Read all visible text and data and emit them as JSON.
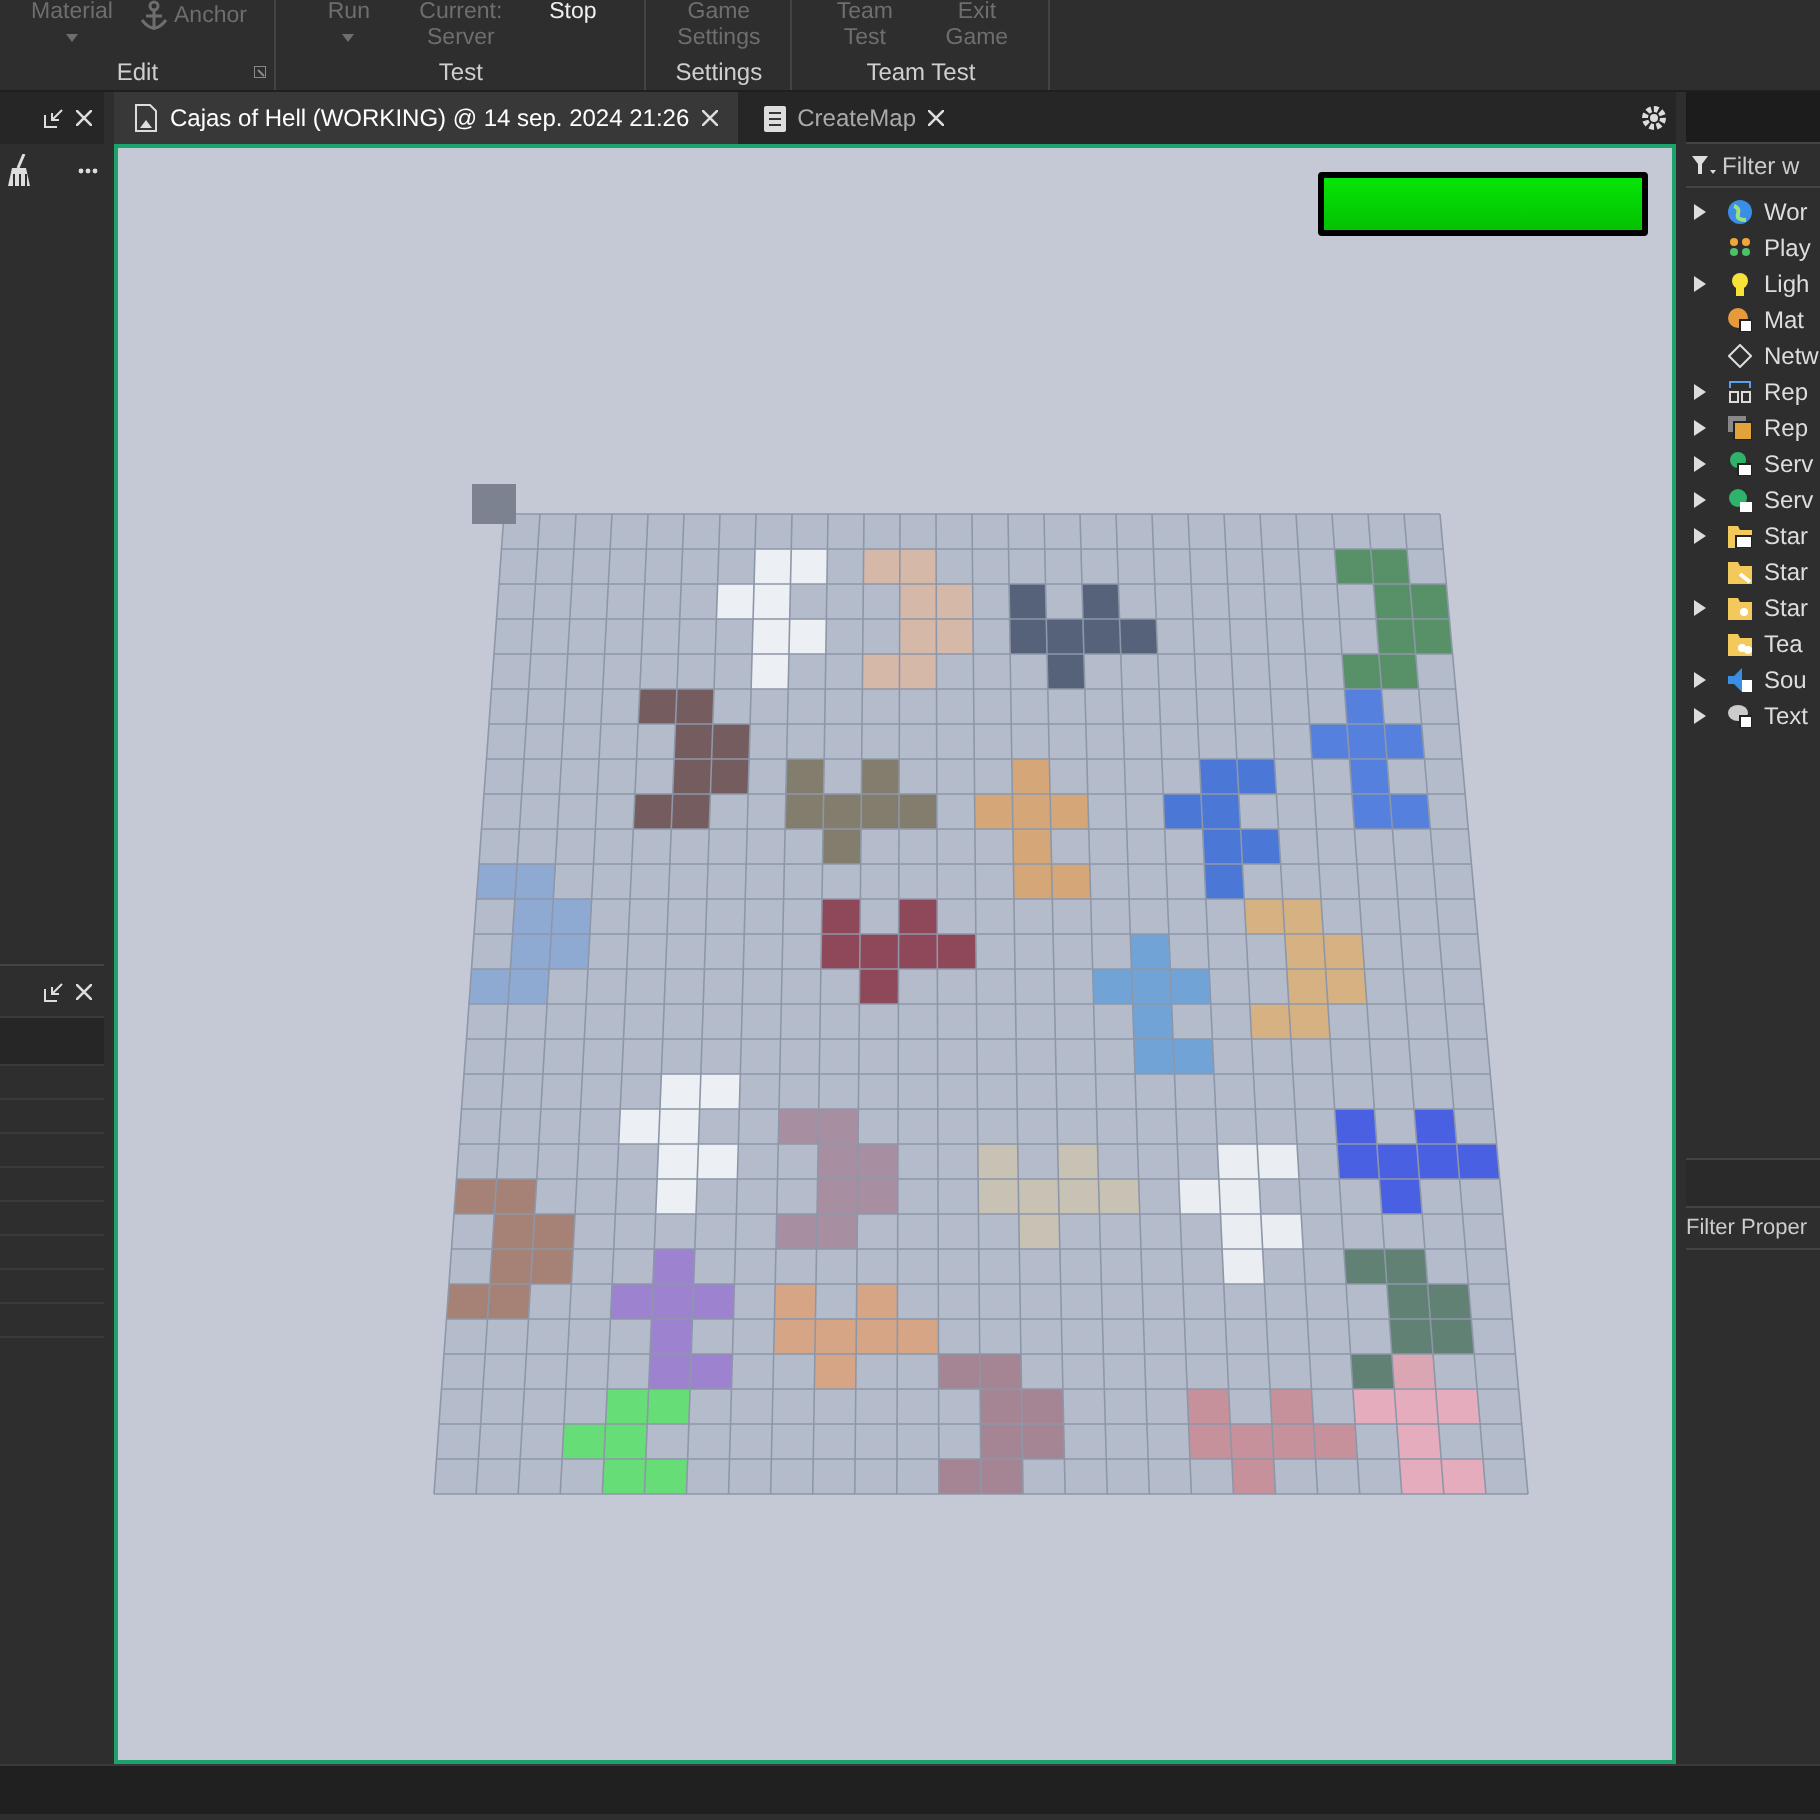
{
  "ribbon": {
    "groups": [
      {
        "label": "Edit",
        "launcher": true,
        "buttons": [
          {
            "label": "Material",
            "disabled": true,
            "kind": "dropdown"
          },
          {
            "label": "Anchor",
            "disabled": true,
            "kind": "anchor"
          }
        ]
      },
      {
        "label": "Test",
        "buttons": [
          {
            "label": "Run",
            "disabled": true,
            "kind": "dropdown"
          },
          {
            "label": "Current: Server",
            "disabled": true,
            "kind": "plain"
          },
          {
            "label": "Stop",
            "disabled": false,
            "kind": "plain"
          }
        ]
      },
      {
        "label": "Settings",
        "buttons": [
          {
            "label": "Game Settings",
            "disabled": true,
            "kind": "plain"
          }
        ]
      },
      {
        "label": "Team Test",
        "buttons": [
          {
            "label": "Team Test",
            "disabled": true,
            "kind": "plain"
          },
          {
            "label": "Exit Game",
            "disabled": true,
            "kind": "plain"
          }
        ]
      }
    ]
  },
  "tabs": [
    {
      "label": "Cajas of Hell (WORKING) @ 14 sep. 2024 21:26",
      "kind": "place",
      "selected": true
    },
    {
      "label": "CreateMap",
      "kind": "script",
      "selected": false
    }
  ],
  "viewport": {
    "health_bar": {
      "level": 1
    }
  },
  "explorer": {
    "filter": {
      "placeholder": "Filter w"
    },
    "items": [
      {
        "label": "Wor",
        "expandable": true
      },
      {
        "label": "Play",
        "expandable": false
      },
      {
        "label": "Ligh",
        "expandable": true
      },
      {
        "label": "Mat",
        "expandable": false
      },
      {
        "label": "Netw",
        "expandable": false
      },
      {
        "label": "Rep",
        "expandable": true
      },
      {
        "label": "Rep",
        "expandable": true
      },
      {
        "label": "Serv",
        "expandable": true
      },
      {
        "label": "Serv",
        "expandable": true
      },
      {
        "label": "Star",
        "expandable": true
      },
      {
        "label": "Star",
        "expandable": false
      },
      {
        "label": "Star",
        "expandable": true
      },
      {
        "label": "Tea",
        "expandable": false
      },
      {
        "label": "Sou",
        "expandable": true
      },
      {
        "label": "Text",
        "expandable": true
      }
    ]
  },
  "properties": {
    "filter": {
      "placeholder": "Filter Proper"
    }
  }
}
